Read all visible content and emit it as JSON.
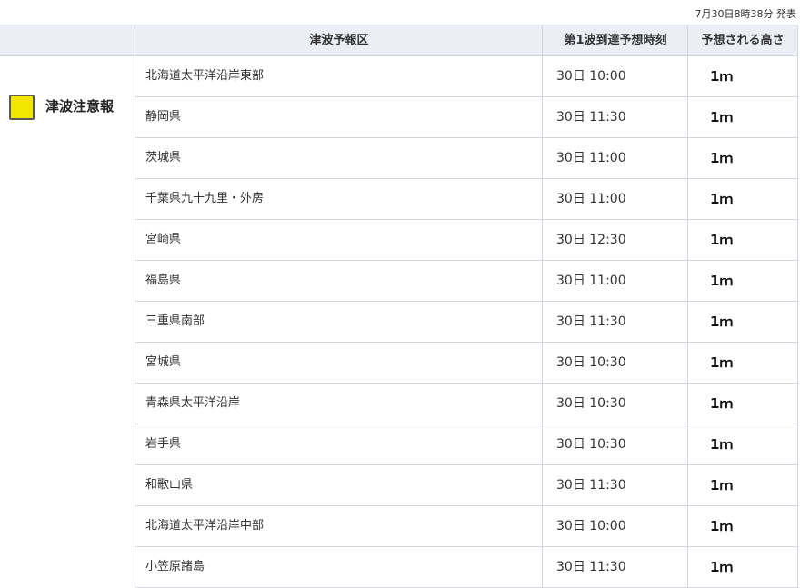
{
  "issued": "7月30日8時38分 発表",
  "header": {
    "area": "津波予報区",
    "arrival": "第1波到達予想時刻",
    "height": "予想される高さ"
  },
  "level": {
    "label": "津波注意報",
    "color": "#f2e600"
  },
  "rows": [
    {
      "area": "北海道太平洋沿岸東部",
      "time": "30日 10:00",
      "height": "1ｍ"
    },
    {
      "area": "静岡県",
      "time": "30日 11:30",
      "height": "1ｍ"
    },
    {
      "area": "茨城県",
      "time": "30日 11:00",
      "height": "1ｍ"
    },
    {
      "area": "千葉県九十九里・外房",
      "time": "30日 11:00",
      "height": "1ｍ"
    },
    {
      "area": "宮崎県",
      "time": "30日 12:30",
      "height": "1ｍ"
    },
    {
      "area": "福島県",
      "time": "30日 11:00",
      "height": "1ｍ"
    },
    {
      "area": "三重県南部",
      "time": "30日 11:30",
      "height": "1ｍ"
    },
    {
      "area": "宮城県",
      "time": "30日 10:30",
      "height": "1ｍ"
    },
    {
      "area": "青森県太平洋沿岸",
      "time": "30日 10:30",
      "height": "1ｍ"
    },
    {
      "area": "岩手県",
      "time": "30日 10:30",
      "height": "1ｍ"
    },
    {
      "area": "和歌山県",
      "time": "30日 11:30",
      "height": "1ｍ"
    },
    {
      "area": "北海道太平洋沿岸中部",
      "time": "30日 10:00",
      "height": "1ｍ"
    },
    {
      "area": "小笠原諸島",
      "time": "30日 11:30",
      "height": "1ｍ"
    }
  ]
}
